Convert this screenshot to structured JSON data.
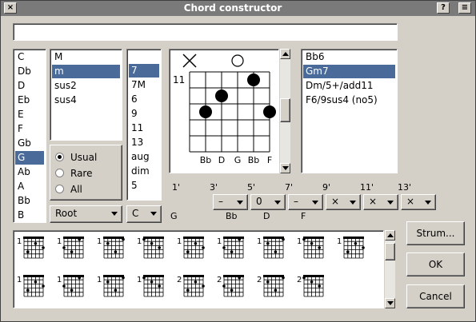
{
  "window": {
    "title": "Chord constructor",
    "help_btn": "?",
    "menu_btn": "≡",
    "close_btn": "×"
  },
  "name_input": {
    "value": ""
  },
  "roots": {
    "items": [
      "C",
      "Db",
      "D",
      "Eb",
      "E",
      "F",
      "Gb",
      "G",
      "Ab",
      "A",
      "Bb",
      "B"
    ],
    "selected": "G"
  },
  "chord_types": {
    "items": [
      "M",
      "m",
      "sus2",
      "sus4"
    ],
    "selected": "m"
  },
  "extensions": {
    "items": [
      "7",
      "7M",
      "6",
      "9",
      "11",
      "13",
      "aug",
      "dim",
      "5"
    ],
    "selected": "7"
  },
  "frequency": {
    "options": [
      "Usual",
      "Rare",
      "All"
    ],
    "selected": "Usual"
  },
  "bass_mode": {
    "value": "Root"
  },
  "bass_note": {
    "value": "C"
  },
  "diagram": {
    "fret": "11",
    "open_markers": [
      "×",
      "",
      "",
      "○",
      "",
      ""
    ],
    "strings": 6,
    "frets": 5,
    "dots": [
      {
        "string": 2,
        "fret": 3
      },
      {
        "string": 3,
        "fret": 2
      },
      {
        "string": 5,
        "fret": 1
      },
      {
        "string": 6,
        "fret": 3
      }
    ],
    "notes": [
      "",
      "Bb",
      "D",
      "G",
      "Bb",
      "F"
    ]
  },
  "names": {
    "items": [
      "Bb6",
      "Gm7",
      "Dm/5+/add11",
      "F6/9sus4 (no5)"
    ],
    "selected": "Gm7"
  },
  "steps": [
    {
      "label": "1'",
      "value": null,
      "note": "G"
    },
    {
      "label": "3'",
      "value": "–",
      "note": "Bb"
    },
    {
      "label": "5'",
      "value": "0",
      "note": "D"
    },
    {
      "label": "7'",
      "value": "–",
      "note": "F"
    },
    {
      "label": "9'",
      "value": "×",
      "note": ""
    },
    {
      "label": "11'",
      "value": "×",
      "note": ""
    },
    {
      "label": "13'",
      "value": "×",
      "note": ""
    }
  ],
  "variants": {
    "row1_frets": [
      "1",
      "1",
      "1",
      "1",
      "1",
      "1",
      "1",
      "1",
      "1"
    ],
    "row2_frets": [
      "1",
      "1",
      "1",
      "1",
      "2",
      "2",
      "2",
      "2"
    ]
  },
  "buttons": {
    "strum": "Strum...",
    "ok": "OK",
    "cancel": "Cancel"
  },
  "colors": {
    "selection": "#4a6a9a",
    "titlebar": "#7a7a7a",
    "face": "#d4d0c8"
  }
}
